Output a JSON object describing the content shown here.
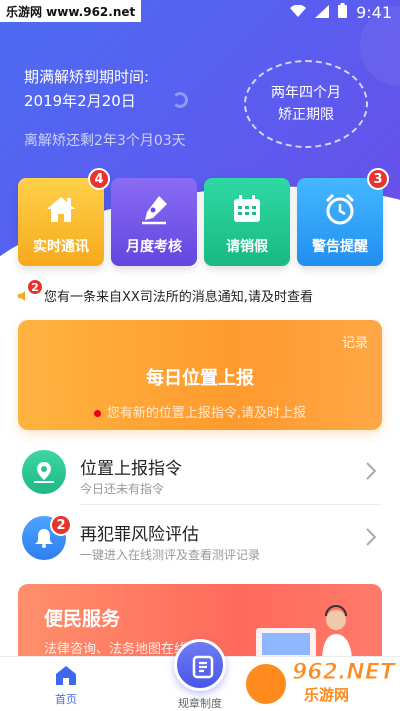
{
  "colors": {
    "hero_bg": "#5366f0",
    "accent": "#3f68f0",
    "badge": "#e8332e",
    "daily_card": "#ffa33a",
    "convenience_card": "#ff6e5e"
  },
  "status_bar": {
    "site_tag": "乐游网 www.962.net",
    "time": "9:41",
    "icons": [
      "wifi-icon",
      "signal-icon",
      "battery-icon"
    ]
  },
  "header": {
    "release_label": "期满解矫到期时间:",
    "release_date": "2019年2月20日",
    "remaining": "离解矫还剩2年3个月03天",
    "period_line1": "两年四个月",
    "period_line2": "矫正期限"
  },
  "tiles": [
    {
      "label": "实时通讯",
      "icon": "home-icon",
      "badge": "4"
    },
    {
      "label": "月度考核",
      "icon": "pen-icon",
      "badge": ""
    },
    {
      "label": "请销假",
      "icon": "calendar-icon",
      "badge": ""
    },
    {
      "label": "警告提醒",
      "icon": "alarm-clock-icon",
      "badge": "3"
    }
  ],
  "notice": {
    "badge": "2",
    "text": "您有一条来自XX司法所的消息通知,请及时查看",
    "icon": "speaker-icon"
  },
  "daily_report": {
    "corner_label": "记录",
    "title": "每日位置上报",
    "subtitle": "您有新的位置上报指令,请及时上报"
  },
  "list": [
    {
      "title": "位置上报指令",
      "subtitle": "今日还未有指令",
      "icon": "map-pin-icon",
      "badge": ""
    },
    {
      "title": "再犯罪风险评估",
      "subtitle": "一键进入在线测评及查看测评记录",
      "icon": "bell-icon",
      "badge": "2"
    }
  ],
  "convenience": {
    "title": "便民服务",
    "subtitle": "法律咨询、法务地图在线"
  },
  "tabbar": {
    "home_label": "首页",
    "center_label": "规章制度"
  },
  "watermark": {
    "line1": "962.NET",
    "line2": "乐游网"
  }
}
